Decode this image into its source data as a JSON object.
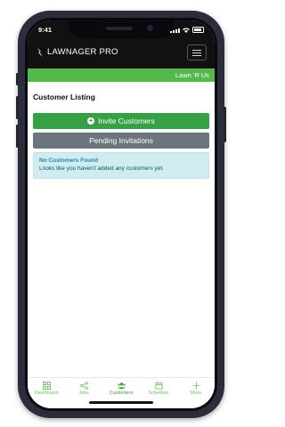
{
  "status_bar": {
    "time": "9:41"
  },
  "app": {
    "brand_name": "LAWNAGER PRO",
    "company": "Lawn 'R Us"
  },
  "page": {
    "title": "Customer Listing",
    "invite_button": "Invite Customers",
    "pending_button": "Pending Invitations",
    "alert": {
      "title": "No Customers Found",
      "message": "Looks like you haven't added any customers yet."
    }
  },
  "nav": {
    "items": [
      {
        "label": "Dashboard",
        "icon": "grid-icon"
      },
      {
        "label": "Jobs",
        "icon": "share-icon"
      },
      {
        "label": "Customers",
        "icon": "people-icon"
      },
      {
        "label": "Schedule",
        "icon": "calendar-icon"
      },
      {
        "label": "More",
        "icon": "plus-icon"
      }
    ],
    "active": "Customers"
  },
  "colors": {
    "accent_green": "#55b84a",
    "button_green": "#35a046",
    "button_gray": "#6c757d",
    "alert_bg": "#d1ecf1",
    "alert_title": "#1e88b4"
  }
}
